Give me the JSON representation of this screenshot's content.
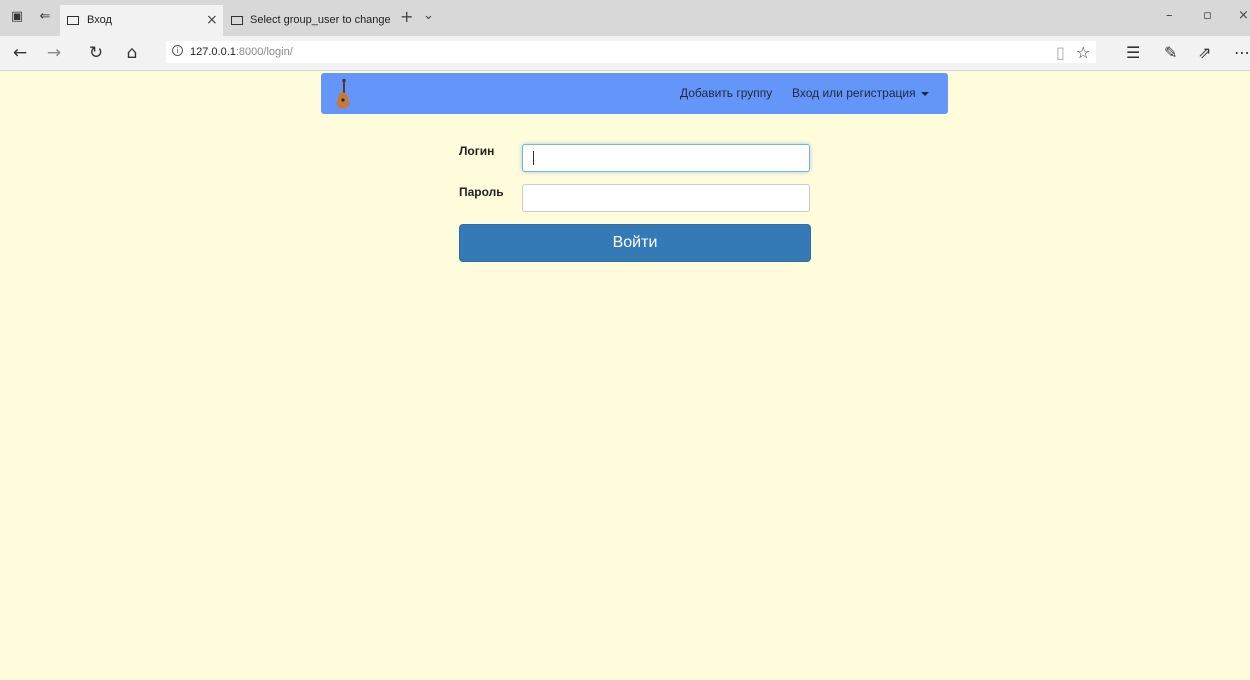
{
  "browser": {
    "tabs": [
      {
        "label": "Вход",
        "active": true
      },
      {
        "label": "Select group_user to change",
        "active": false
      }
    ],
    "url": {
      "host": "127.0.0.1",
      "path": ":8000/login/"
    },
    "icons": {
      "set_aside": "tabs-aside-icon",
      "restore_tabs": "restore-tabs-icon",
      "back": "back-arrow-icon",
      "forward": "forward-arrow-icon",
      "refresh": "refresh-icon",
      "home": "home-icon",
      "reading_view": "reading-view-icon",
      "favorite": "star-icon",
      "favorites_list": "favorites-list-icon",
      "notes": "pen-icon",
      "share": "share-icon",
      "more": "more-icon"
    }
  },
  "navbar": {
    "color": "#6496fa",
    "brand_icon": "guitar-icon",
    "add_group": "Добавить группу",
    "auth_menu": "Вход или регистрация"
  },
  "form": {
    "login_label": "Логин",
    "login_value": "",
    "password_label": "Пароль",
    "password_value": "",
    "submit_label": "Войти",
    "submit_color": "#337ab7"
  },
  "page": {
    "background": "#fffcdb"
  }
}
